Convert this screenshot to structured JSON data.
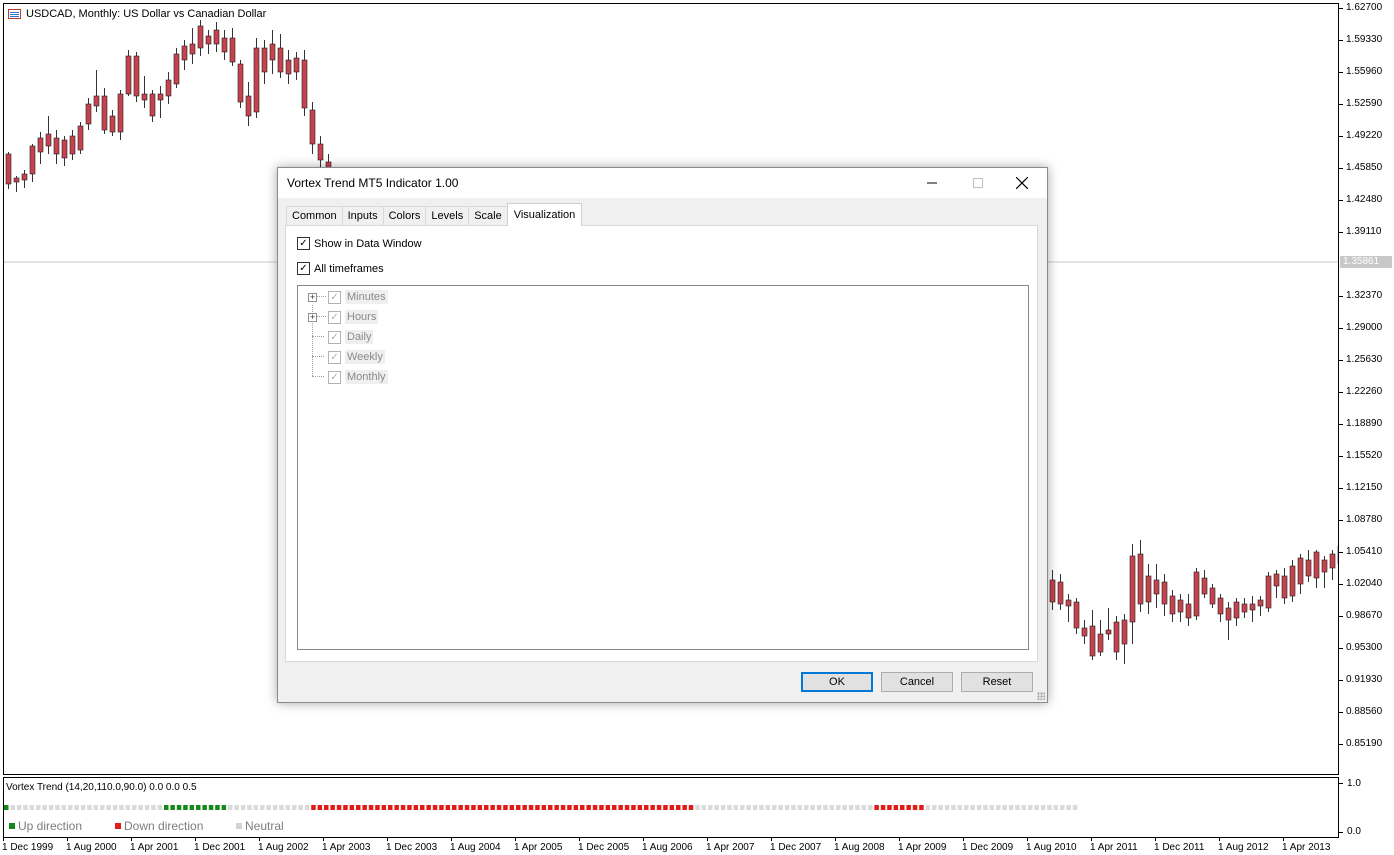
{
  "chart": {
    "title": "USDCAD, Monthly:  US Dollar vs Canadian Dollar",
    "icon": "candlestick-chart-icon",
    "current_price": "1.35861",
    "colors": {
      "bull": "#5f7478",
      "bear": "#c5434d",
      "up": "#13891b",
      "down": "#e11b16",
      "neutral": "#dadada"
    }
  },
  "price_axis": [
    "1.62700",
    "1.59330",
    "1.55960",
    "1.52590",
    "1.49220",
    "1.45850",
    "1.42480",
    "1.39110",
    "1.32370",
    "1.29000",
    "1.25630",
    "1.22260",
    "1.18890",
    "1.15520",
    "1.12150",
    "1.08780",
    "1.05410",
    "1.02040",
    "0.98670",
    "0.95300",
    "0.91930",
    "0.88560",
    "0.85190"
  ],
  "time_axis": [
    "1 Dec 1999",
    "1 Aug 2000",
    "1 Apr 2001",
    "1 Dec 2001",
    "1 Aug 2002",
    "1 Apr 2003",
    "1 Dec 2003",
    "1 Aug 2004",
    "1 Apr 2005",
    "1 Dec 2005",
    "1 Aug 2006",
    "1 Apr 2007",
    "1 Dec 2007",
    "1 Aug 2008",
    "1 Apr 2009",
    "1 Dec 2009",
    "1 Aug 2010",
    "1 Apr 2011",
    "1 Dec 2011",
    "1 Aug 2012",
    "1 Apr 2013"
  ],
  "indicator": {
    "title": "Vortex Trend (14,20,110.0,90.0) 0.0 0.0 0.5",
    "scale_top": "1.0",
    "scale_bottom": "0.0",
    "legend": [
      {
        "label": "Up direction",
        "color": "#13891b"
      },
      {
        "label": "Down direction",
        "color": "#e11b16"
      },
      {
        "label": "Neutral",
        "color": "#d3d3d3"
      }
    ],
    "segments": [
      {
        "state": "up",
        "count": 1
      },
      {
        "state": "neutral",
        "count": 24
      },
      {
        "state": "up",
        "count": 10
      },
      {
        "state": "neutral",
        "count": 13
      },
      {
        "state": "down",
        "count": 60
      },
      {
        "state": "neutral",
        "count": 28
      },
      {
        "state": "down",
        "count": 8
      },
      {
        "state": "neutral",
        "count": 24
      }
    ]
  },
  "dialog": {
    "title": "Vortex Trend MT5 Indicator 1.00",
    "minimize_icon": "minimize-icon",
    "maximize_icon": "maximize-icon",
    "close_icon": "close-icon",
    "tabs": [
      "Common",
      "Inputs",
      "Colors",
      "Levels",
      "Scale",
      "Visualization"
    ],
    "active_tab": "Visualization",
    "show_in_data_window": {
      "label": "Show in Data Window",
      "checked": true
    },
    "all_timeframes": {
      "label": "All timeframes",
      "checked": true
    },
    "timeframes": [
      {
        "label": "Minutes",
        "expandable": true,
        "checked": true
      },
      {
        "label": "Hours",
        "expandable": true,
        "checked": true
      },
      {
        "label": "Daily",
        "expandable": false,
        "checked": true
      },
      {
        "label": "Weekly",
        "expandable": false,
        "checked": true
      },
      {
        "label": "Monthly",
        "expandable": false,
        "checked": true
      }
    ],
    "buttons": {
      "ok": "OK",
      "cancel": "Cancel",
      "reset": "Reset"
    }
  }
}
